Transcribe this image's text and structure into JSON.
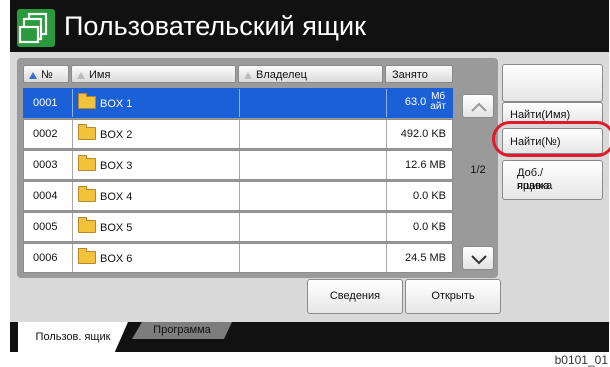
{
  "header": {
    "title": "Пользовательский ящик",
    "icon": "user-box-icon"
  },
  "columns": {
    "no": "№",
    "name": "Имя",
    "owner": "Владелец",
    "used": "Занято"
  },
  "rows": [
    {
      "no": "0001",
      "name": "BOX 1",
      "owner": "",
      "size": "63.0",
      "unit_top": "Мб",
      "unit_bottom": "айт",
      "selected": true
    },
    {
      "no": "0002",
      "name": "BOX 2",
      "owner": "",
      "size": "492.0 KB",
      "selected": false
    },
    {
      "no": "0003",
      "name": "BOX 3",
      "owner": "",
      "size": "12.6 MB",
      "selected": false
    },
    {
      "no": "0004",
      "name": "BOX 4",
      "owner": "",
      "size": "0.0 KB",
      "selected": false
    },
    {
      "no": "0005",
      "name": "BOX 5",
      "owner": "",
      "size": "0.0 KB",
      "selected": false
    },
    {
      "no": "0006",
      "name": "BOX 6",
      "owner": "",
      "size": "24.5 MB",
      "selected": false
    }
  ],
  "pager": {
    "page": "1/2"
  },
  "side": {
    "search_name": "Найти(Имя)",
    "search_no": "Найти(№)",
    "add_edit_line1": "Доб./правка",
    "add_edit_line2": "ящика"
  },
  "actions": {
    "details": "Сведения",
    "open": "Открыть"
  },
  "tabs": {
    "user_box": "Пользов. ящик",
    "program": "Программа"
  },
  "caption": "b0101_01",
  "colors": {
    "accent": "#1b60d6",
    "highlight_ring": "#e0192b",
    "icon_green": "#2a9a3c"
  }
}
